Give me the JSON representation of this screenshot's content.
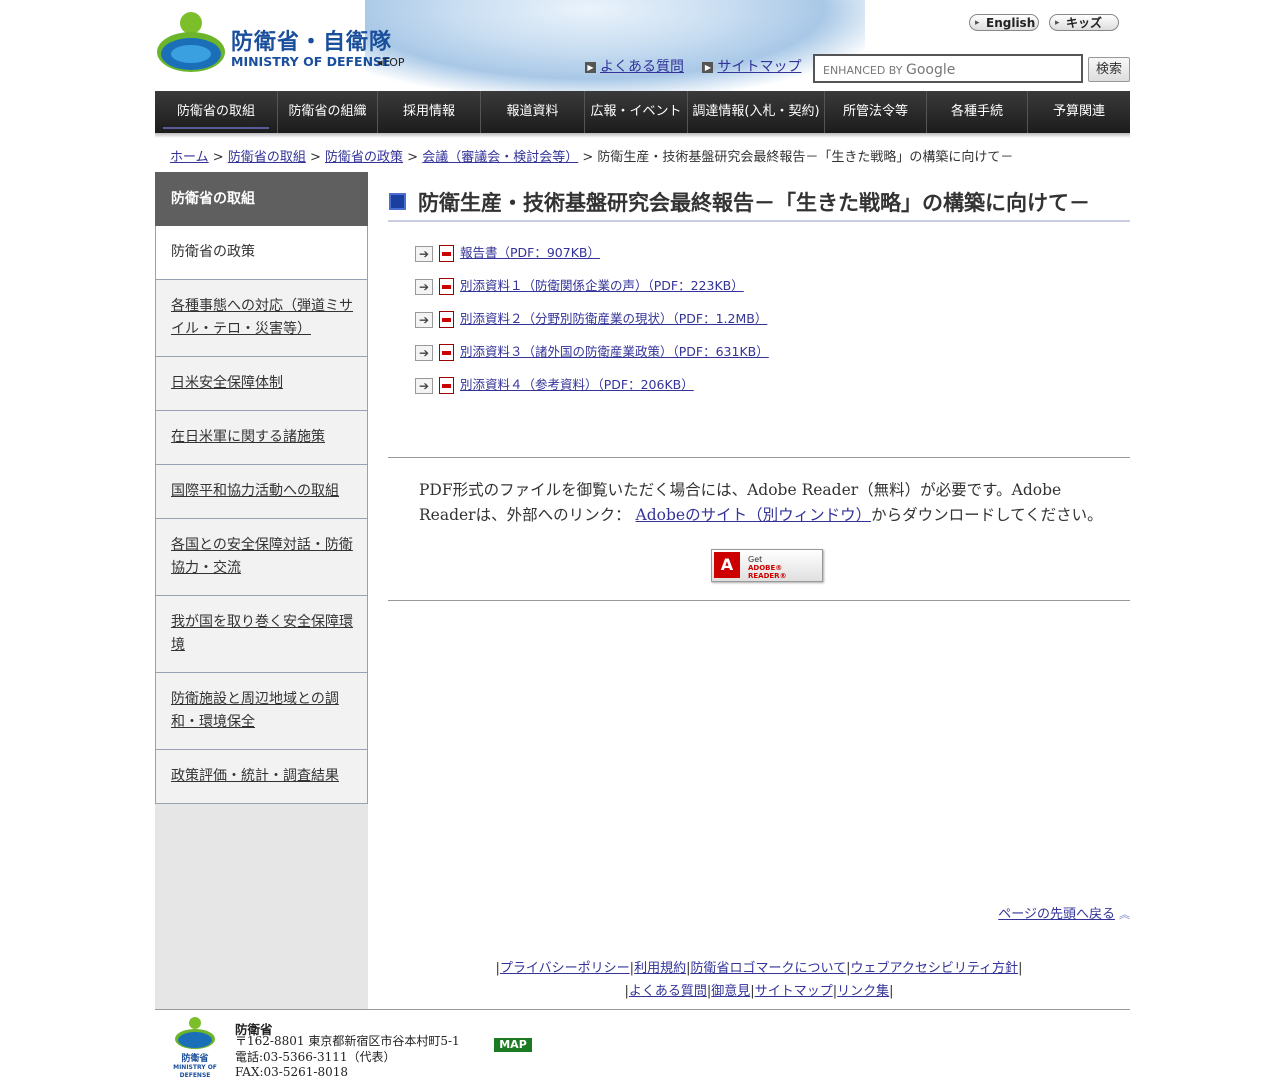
{
  "header": {
    "logo_ja": "防衛省・自衛隊",
    "logo_en": "MINISTRY OF DEFENSE",
    "top_link": "◂TOP",
    "english_btn": "English",
    "kids_btn": "キッズ",
    "faq_link": "よくある質問",
    "sitemap_link": "サイトマップ",
    "search_placeholder_small": "ENHANCED BY",
    "search_placeholder_brand": "Google",
    "search_button": "検索"
  },
  "nav": {
    "items": [
      "防衛省の取組",
      "防衛省の組織",
      "採用情報",
      "報道資料",
      "広報・イベント",
      "調達情報(入札・契約)",
      "所管法令等",
      "各種手続",
      "予算関連"
    ]
  },
  "breadcrumb": {
    "items": [
      "ホーム",
      "防衛省の取組",
      "防衛省の政策",
      "会議（審議会・検討会等）"
    ],
    "current": "防衛生産・技術基盤研究会最終報告－「生きた戦略」の構築に向けて－",
    "sep": ">"
  },
  "sidebar": {
    "heading": "防衛省の取組",
    "items": [
      "防衛省の政策",
      "各種事態への対応（弾道ミサイル・テロ・災害等）",
      "日米安全保障体制",
      "在日米軍に関する諸施策",
      "国際平和協力活動への取組",
      "各国との安全保障対話・防衛協力・交流",
      "我が国を取り巻く安全保障環境",
      "防衛施設と周辺地域との調和・環境保全",
      "政策評価・統計・調査結果"
    ]
  },
  "main": {
    "title": "防衛生産・技術基盤研究会最終報告－「生きた戦略」の構築に向けて－",
    "documents": [
      "報告書（PDF：907KB）",
      "別添資料１（防衛関係企業の声）（PDF：223KB）",
      "別添資料２（分野別防衛産業の現状）（PDF：1.2MB）",
      "別添資料３（諸外国の防衛産業政策）（PDF：631KB）",
      "別添資料４（参考資料）（PDF：206KB）"
    ],
    "pdf_note_1": "PDF形式のファイルを御覧いただく場合には、Adobe Reader（無料）が必要です。Adobe Readerは、",
    "pdf_note_alt": "外部へのリンク：",
    "pdf_note_link": "Adobeのサイト（別ウィンドウ）",
    "pdf_note_2": "からダウンロードしてください。",
    "get_reader_1": "Get",
    "get_reader_2": "ADOBE® READER®",
    "page_top": "ページの先頭へ戻る"
  },
  "footer_links": {
    "row1": [
      "プライバシーポリシー",
      "利用規約",
      "防衛省ロゴマークについて",
      "ウェブアクセシビリティ方針"
    ],
    "row2": [
      "よくある質問",
      "御意見",
      "サイトマップ",
      "リンク集"
    ],
    "sep": "|"
  },
  "footer": {
    "org": "防衛省",
    "address": "〒162-8801 東京都新宿区市谷本村町5-1",
    "phone": "電話:03-5366-3111（代表）",
    "fax": "FAX:03-5261-8018",
    "map": "MAP",
    "logo_text_1": "防衛省",
    "logo_text_2": "MINISTRY OF",
    "logo_text_3": "DEFENSE"
  },
  "colors": {
    "accent_blue": "#1a4f9c",
    "link": "#333399",
    "nav_bg": "#262626",
    "map_green": "#1c7a22"
  }
}
